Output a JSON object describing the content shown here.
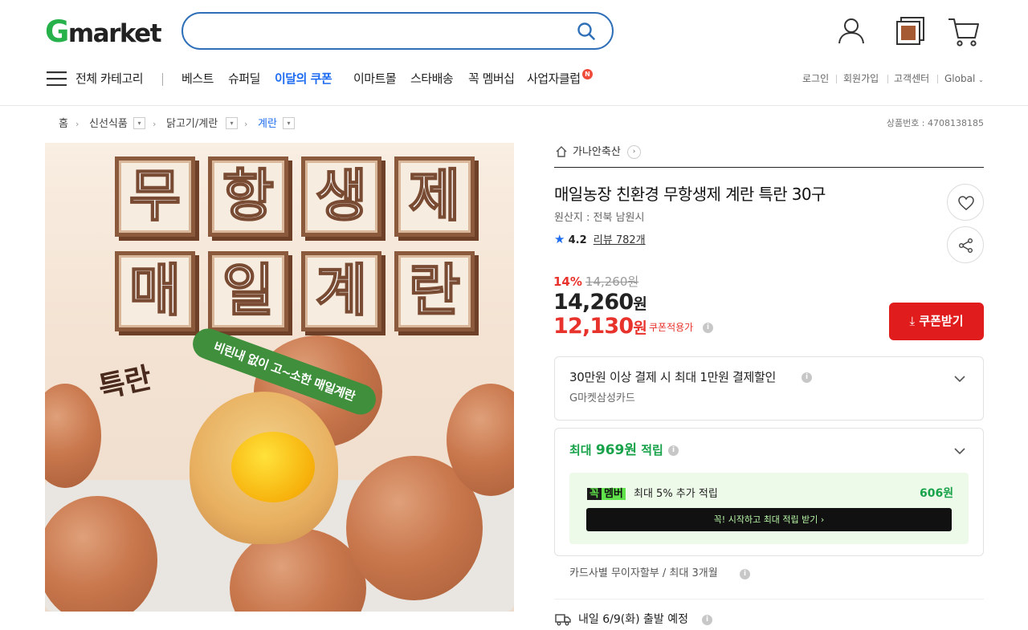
{
  "header": {
    "logo_g": "G",
    "logo_rest": "market",
    "search": {
      "value": "",
      "placeholder": ""
    },
    "icons": [
      "user-icon",
      "recent-view-icon",
      "cart-icon"
    ]
  },
  "nav": {
    "all_categories": "전체 카테고리",
    "items": [
      "베스트",
      "슈퍼딜",
      "이달의 쿠폰",
      "이마트몰",
      "스타배송",
      "꼭 멤버십",
      "사업자클럽"
    ],
    "new_badge": "N",
    "util": [
      "로그인",
      "회원가입",
      "고객센터",
      "Global"
    ]
  },
  "breadcrumb": {
    "items": [
      "홈",
      "신선식품",
      "닭고기/계란",
      "계란"
    ],
    "product_no": "상품번호 : 4708138185"
  },
  "image": {
    "chars": [
      "무",
      "항",
      "생",
      "제",
      "매",
      "일",
      "계",
      "란"
    ],
    "seal": "특란",
    "banner": "비린내 없이 고~소한 매일계란"
  },
  "product": {
    "seller": "가나안축산",
    "title": "매일농장 친환경 무항생제 계란 특란 30구",
    "origin": "원산지 : 전북 남원시",
    "rating": "4.2",
    "reviews": "리뷰 782개",
    "discount_pct": "14%",
    "original_price": "14,260원",
    "price_num": "14,260",
    "coupon_price_num": "12,130",
    "won": "원",
    "coupon_tag": "쿠폰적용가",
    "coupon_button": "쿠폰받기"
  },
  "benefits": {
    "card_title": "30만원 이상 결제 시 최대 1만원 결제할인",
    "card_sub": "G마켓삼성카드",
    "points_prefix": "최대",
    "points_value": "969원",
    "points_suffix": "적립",
    "member_tag_a": "꼭",
    "member_tag_b": "멤버",
    "member_text": "최대 5% 추가 적립",
    "member_amount": "606원",
    "member_button": "꼭! 시작하고 최대 적립 받기 ›",
    "installment": "카드사별 무이자할부 / 최대 3개월",
    "shipping": "내일 6/9(화) 출발 예정"
  },
  "colors": {
    "brand_green": "#26b14a",
    "accent_blue": "#1d6bf0",
    "sale_red": "#e8322c",
    "coupon_red": "#e11c1c",
    "point_green": "#18a24a"
  }
}
